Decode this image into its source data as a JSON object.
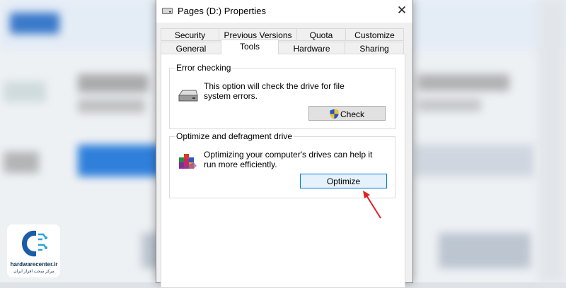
{
  "window": {
    "title": "Pages (D:) Properties",
    "close_glyph": "✕"
  },
  "tabs_row1": [
    {
      "label": "Security"
    },
    {
      "label": "Previous Versions"
    },
    {
      "label": "Quota"
    },
    {
      "label": "Customize"
    }
  ],
  "tabs_row2": [
    {
      "label": "General"
    },
    {
      "label": "Tools",
      "active": true
    },
    {
      "label": "Hardware"
    },
    {
      "label": "Sharing"
    }
  ],
  "error_checking": {
    "title": "Error checking",
    "description": "This option will check the drive for file system errors.",
    "button_label": "Check"
  },
  "optimize": {
    "title": "Optimize and defragment drive",
    "description": "Optimizing your computer's drives can help it run more efficiently.",
    "button_label": "Optimize"
  },
  "watermark": {
    "site": "hardwarecenter.ir",
    "subtitle": "مرکز سخت افزار ایران"
  },
  "colors": {
    "accent": "#0078d7",
    "arrow": "#e02020",
    "brand": "#1b5ea8"
  }
}
